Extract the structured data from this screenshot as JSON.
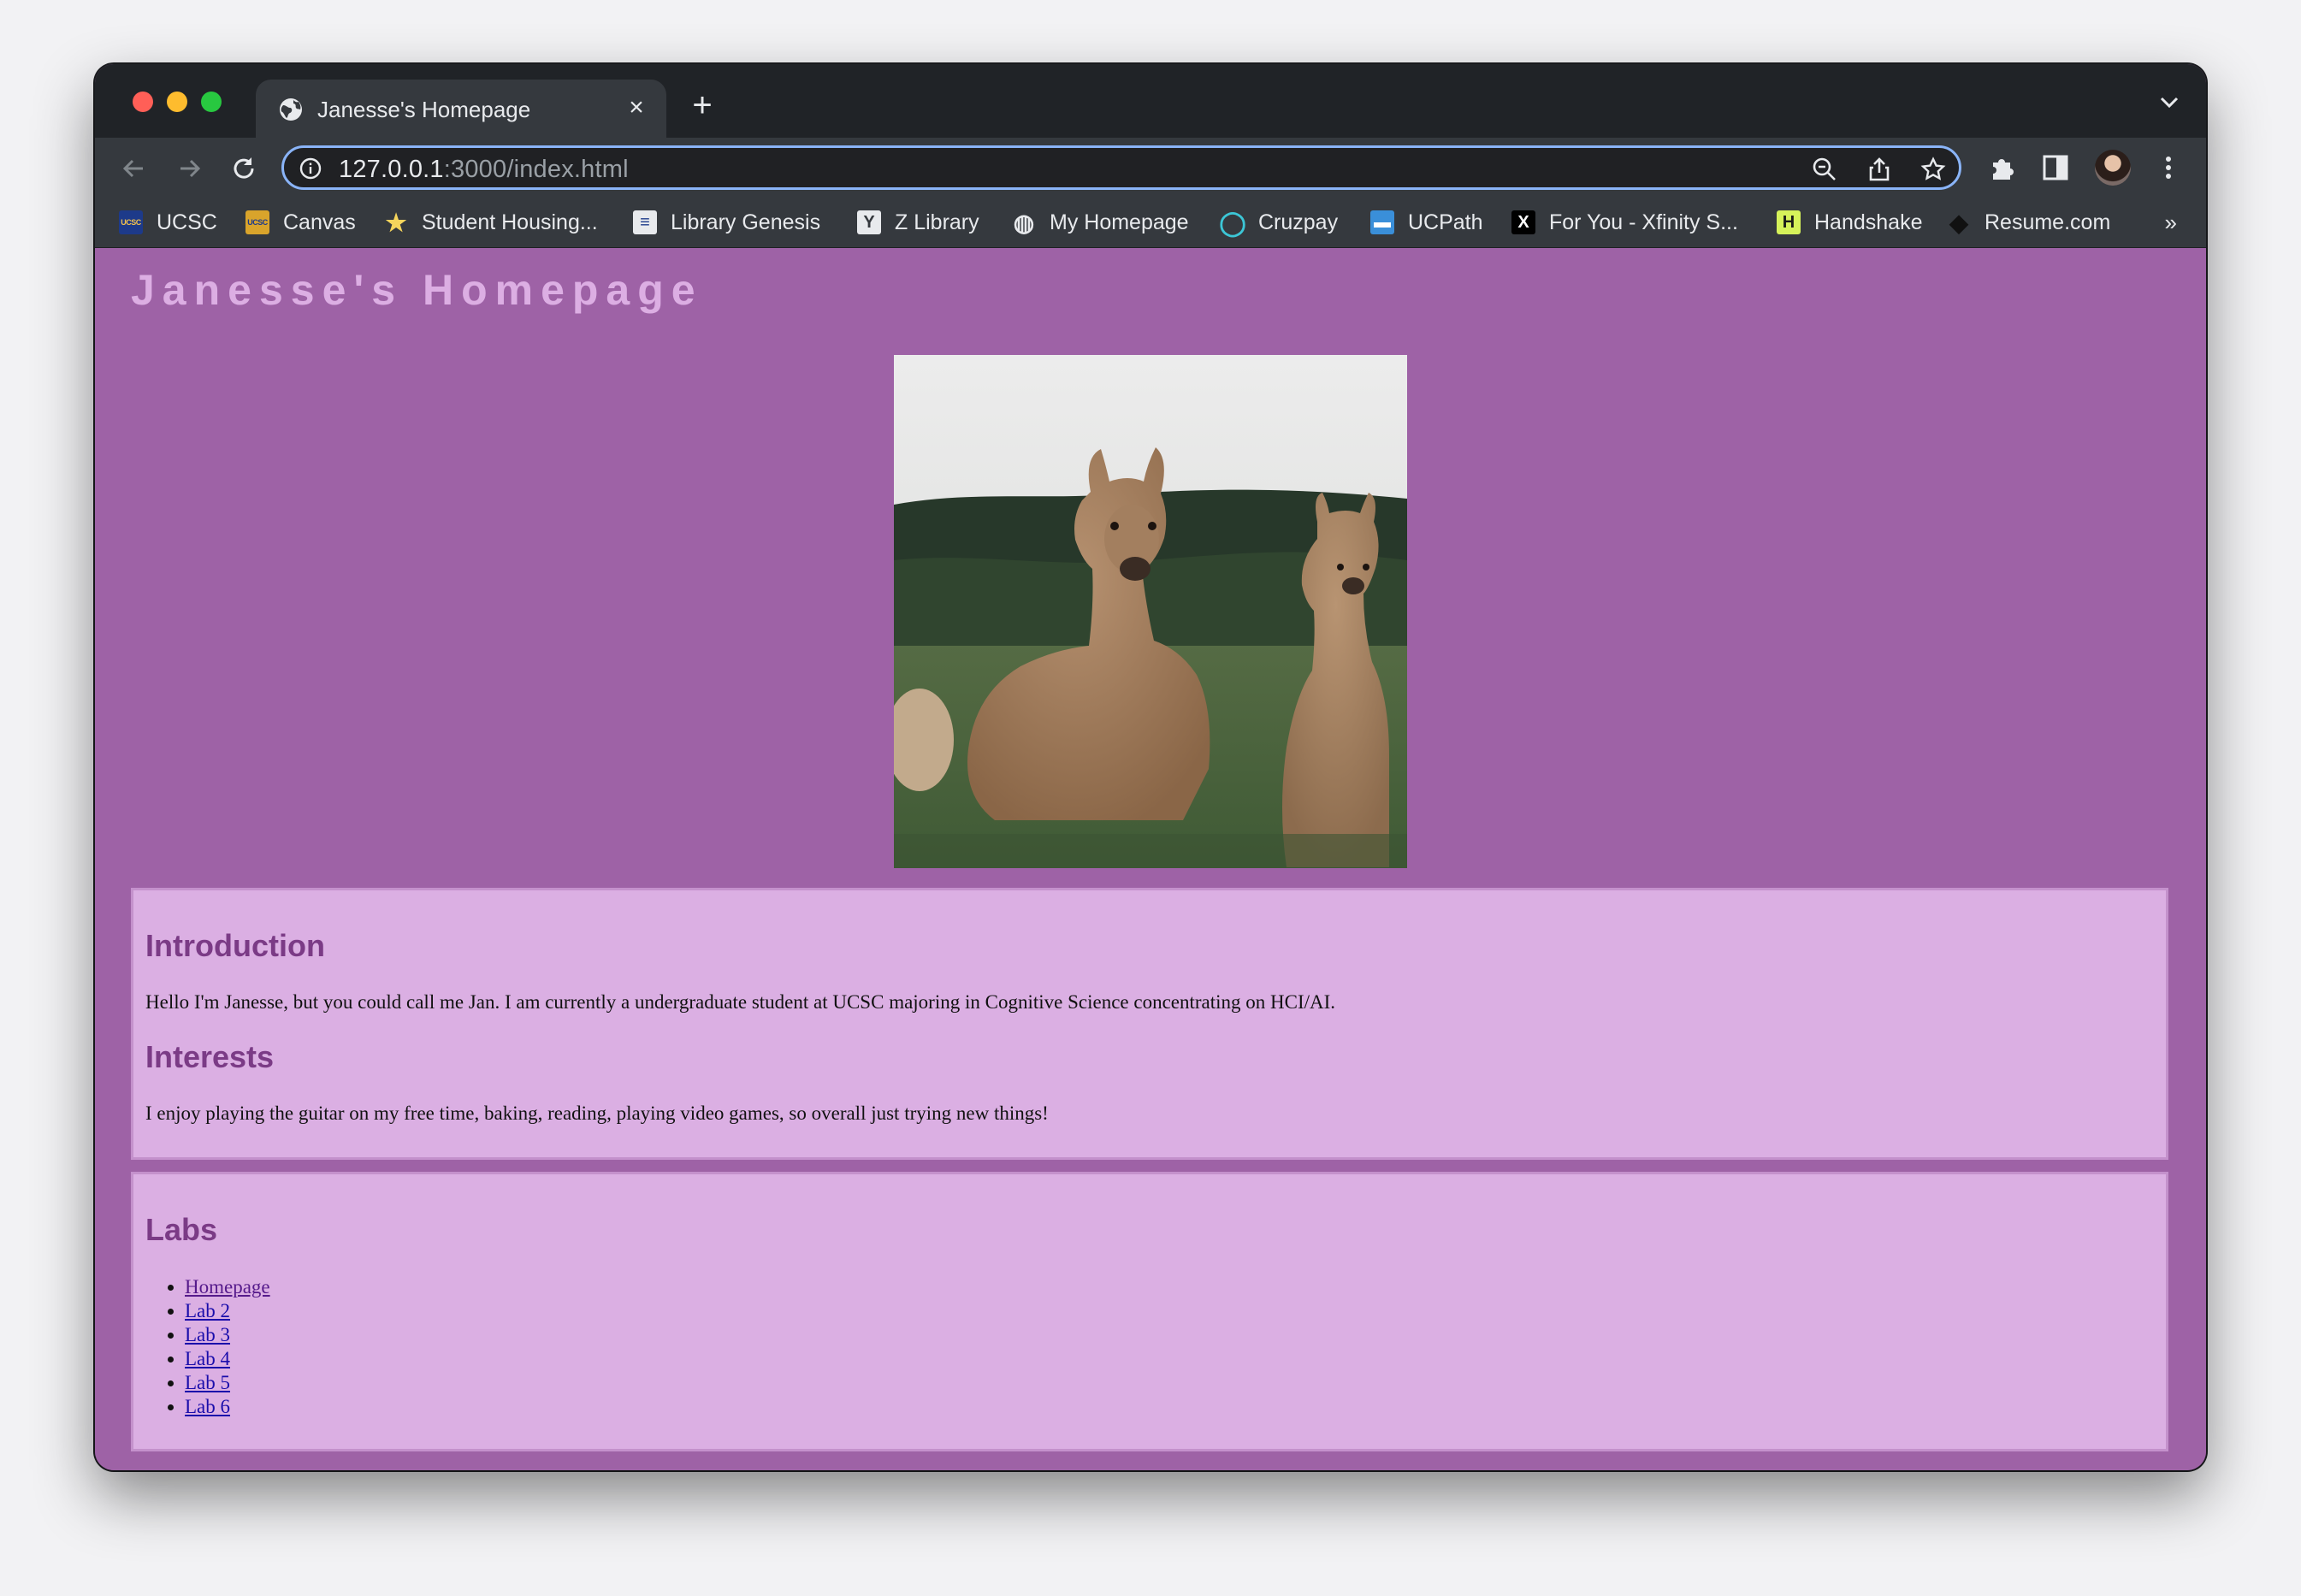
{
  "browser": {
    "tab": {
      "title": "Janesse's Homepage",
      "close_glyph": "×"
    },
    "new_tab_glyph": "+",
    "url": {
      "host": "127.0.0.1",
      "rest": ":3000/index.html"
    },
    "more_bookmarks_glyph": "»"
  },
  "bookmarks": [
    {
      "label": "UCSC",
      "icon": "ucsc-logo-icon",
      "glyph": "UCSC",
      "color": "#1d3a8a",
      "fg": "#f2c14e"
    },
    {
      "label": "Canvas",
      "icon": "ucsc-gold-logo-icon",
      "glyph": "UCSC",
      "color": "#d9a42b",
      "fg": "#1d3a8a"
    },
    {
      "label": "Student Housing...",
      "icon": "star-icon",
      "glyph": "★",
      "color": "transparent",
      "fg": "#f6d55c"
    },
    {
      "label": "Library Genesis",
      "icon": "book-icon",
      "glyph": "≡",
      "color": "#e8eaed",
      "fg": "#1d3a8a"
    },
    {
      "label": "Z Library",
      "icon": "z-library-icon",
      "glyph": "Y",
      "color": "#e8eaed",
      "fg": "#35393e"
    },
    {
      "label": "My Homepage",
      "icon": "globe-icon",
      "glyph": "◍",
      "color": "transparent",
      "fg": "#e8eaed"
    },
    {
      "label": "Cruzpay",
      "icon": "user-icon",
      "glyph": "◯",
      "color": "transparent",
      "fg": "#3cc6d6"
    },
    {
      "label": "UCPath",
      "icon": "ucpath-icon",
      "glyph": "▬",
      "color": "#3a8fd9",
      "fg": "#ffffff"
    },
    {
      "label": "For You - Xfinity S...",
      "icon": "x-icon",
      "glyph": "X",
      "color": "#000000",
      "fg": "#ffffff"
    },
    {
      "label": "Handshake",
      "icon": "handshake-icon",
      "glyph": "H",
      "color": "#d6f25a",
      "fg": "#1a1a1a"
    },
    {
      "label": "Resume.com",
      "icon": "resume-icon",
      "glyph": "◆",
      "color": "transparent",
      "fg": "#111111"
    }
  ],
  "page": {
    "title": "Janesse's Homepage",
    "intro_heading": "Introduction",
    "intro_text": "Hello I'm Janesse, but you could call me Jan. I am currently a undergraduate student at UCSC majoring in Cognitive Science concentrating on HCI/AI.",
    "interests_heading": "Interests",
    "interests_text": "I enjoy playing the guitar on my free time, baking, reading, playing video games, so overall just trying new things!",
    "labs_heading": "Labs",
    "labs": [
      {
        "label": "Homepage",
        "visited": true
      },
      {
        "label": "Lab 2",
        "visited": false
      },
      {
        "label": "Lab 3",
        "visited": false
      },
      {
        "label": "Lab 4",
        "visited": false
      },
      {
        "label": "Lab 5",
        "visited": false
      },
      {
        "label": "Lab 6",
        "visited": false
      }
    ]
  },
  "colors": {
    "page_background": "#9e62a6",
    "card_background": "#dbafe3",
    "heading": "#7b3b86",
    "title": "#dcaee3"
  }
}
